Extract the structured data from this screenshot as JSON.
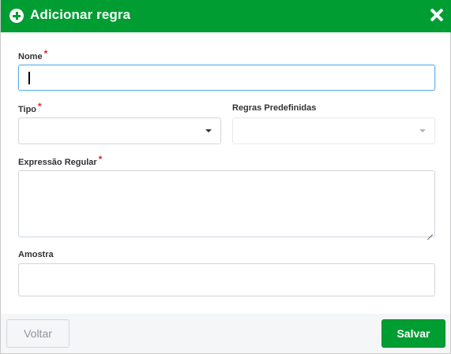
{
  "dialog": {
    "title": "Adicionar regra",
    "header_color": "#009d33",
    "header_icon": "plus-circle-icon",
    "close_icon": "close-icon"
  },
  "form": {
    "nome": {
      "label": "Nome",
      "required_mark": "*",
      "value": ""
    },
    "tipo": {
      "label": "Tipo",
      "required_mark": "*",
      "selected": ""
    },
    "regras_predefinidas": {
      "label": "Regras Predefinidas",
      "selected": "",
      "disabled": true
    },
    "expressao_regular": {
      "label": "Expressão Regular",
      "required_mark": "*",
      "value": ""
    },
    "amostra": {
      "label": "Amostra",
      "value": ""
    }
  },
  "footer": {
    "back_label": "Voltar",
    "save_label": "Salvar",
    "save_color": "#009d33"
  }
}
